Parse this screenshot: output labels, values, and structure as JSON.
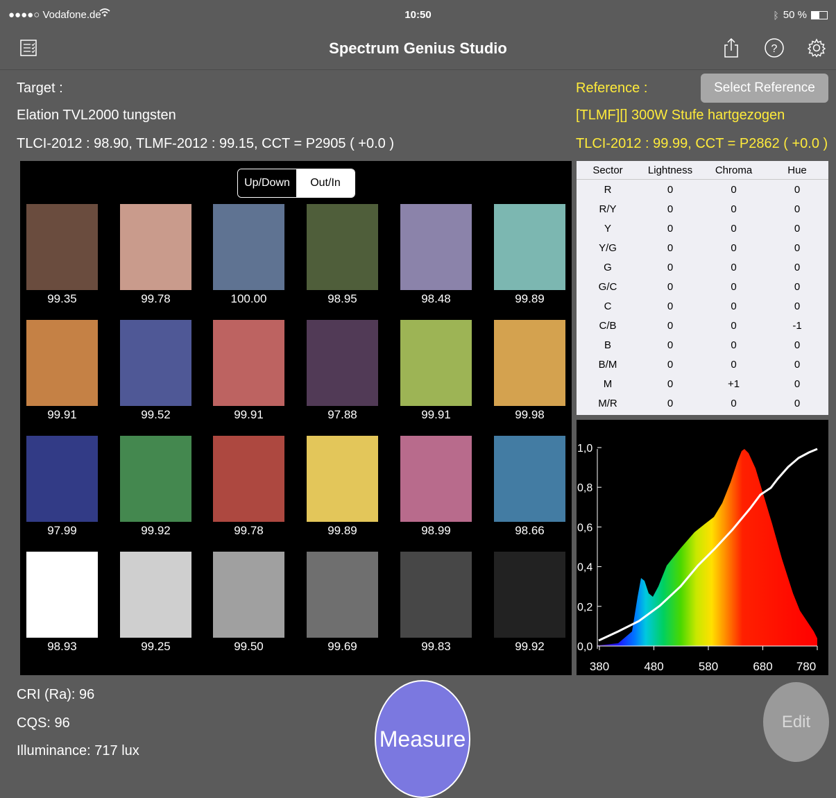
{
  "status_bar": {
    "carrier": "●●●●○ Vodafone.de",
    "time": "10:50",
    "battery_text": "50 %",
    "battery_level": 0.5
  },
  "nav": {
    "title": "Spectrum Genius Studio",
    "left_icon": "list-icon",
    "right_icons": [
      "share-icon",
      "help-icon",
      "gear-icon"
    ]
  },
  "target": {
    "heading": "Target :",
    "name": "Elation TVL2000 tungsten",
    "metrics": "TLCI-2012 : 98.90, TLMF-2012 : 99.15, CCT = P2905 ( +0.0 )"
  },
  "reference": {
    "heading": "Reference :",
    "button": "Select Reference",
    "name": "[TLMF][] 300W Stufe hartgezogen",
    "metrics": "TLCI-2012 : 99.99, CCT = P2862 ( +0.0 )"
  },
  "segment": {
    "options": [
      "Up/Down",
      "Out/In"
    ],
    "selected": "Up/Down"
  },
  "swatches": [
    {
      "color": "#6a4c3e",
      "value": "99.35"
    },
    {
      "color": "#c99b8c",
      "value": "99.78"
    },
    {
      "color": "#5f7392",
      "value": "100.00"
    },
    {
      "color": "#4f5e3a",
      "value": "98.95"
    },
    {
      "color": "#8b83aa",
      "value": "98.48"
    },
    {
      "color": "#7cb7b1",
      "value": "99.89"
    },
    {
      "color": "#c58145",
      "value": "99.91"
    },
    {
      "color": "#4f5896",
      "value": "99.52"
    },
    {
      "color": "#bd6361",
      "value": "99.91"
    },
    {
      "color": "#513a56",
      "value": "97.88"
    },
    {
      "color": "#9db455",
      "value": "99.91"
    },
    {
      "color": "#d4a24f",
      "value": "99.98"
    },
    {
      "color": "#323b86",
      "value": "97.99"
    },
    {
      "color": "#44884f",
      "value": "99.92"
    },
    {
      "color": "#ad4840",
      "value": "99.78"
    },
    {
      "color": "#e3c65a",
      "value": "99.89"
    },
    {
      "color": "#b86b8c",
      "value": "98.99"
    },
    {
      "color": "#437ca3",
      "value": "98.66"
    },
    {
      "color": "#ffffff",
      "value": "98.93"
    },
    {
      "color": "#cfcfcf",
      "value": "99.25"
    },
    {
      "color": "#a0a0a0",
      "value": "99.50"
    },
    {
      "color": "#6f6f6f",
      "value": "99.69"
    },
    {
      "color": "#474747",
      "value": "99.83"
    },
    {
      "color": "#222222",
      "value": "99.92"
    }
  ],
  "sector_table": {
    "headers": [
      "Sector",
      "Lightness",
      "Chroma",
      "Hue"
    ],
    "rows": [
      [
        "R",
        "0",
        "0",
        "0"
      ],
      [
        "R/Y",
        "0",
        "0",
        "0"
      ],
      [
        "Y",
        "0",
        "0",
        "0"
      ],
      [
        "Y/G",
        "0",
        "0",
        "0"
      ],
      [
        "G",
        "0",
        "0",
        "0"
      ],
      [
        "G/C",
        "0",
        "0",
        "0"
      ],
      [
        "C",
        "0",
        "0",
        "0"
      ],
      [
        "C/B",
        "0",
        "0",
        "-1"
      ],
      [
        "B",
        "0",
        "0",
        "0"
      ],
      [
        "B/M",
        "0",
        "0",
        "0"
      ],
      [
        "M",
        "0",
        "+1",
        "0"
      ],
      [
        "M/R",
        "0",
        "0",
        "0"
      ]
    ]
  },
  "spectrum": {
    "y_ticks": [
      "0,0",
      "0,2",
      "0,4",
      "0,6",
      "0,8",
      "1,0"
    ],
    "x_ticks": [
      "380",
      "480",
      "580",
      "680",
      "780"
    ]
  },
  "stats": {
    "cri": "CRI (Ra): 96",
    "cqs": "CQS: 96",
    "illuminance": "Illuminance: 717 lux"
  },
  "buttons": {
    "measure": "Measure",
    "edit": "Edit"
  }
}
